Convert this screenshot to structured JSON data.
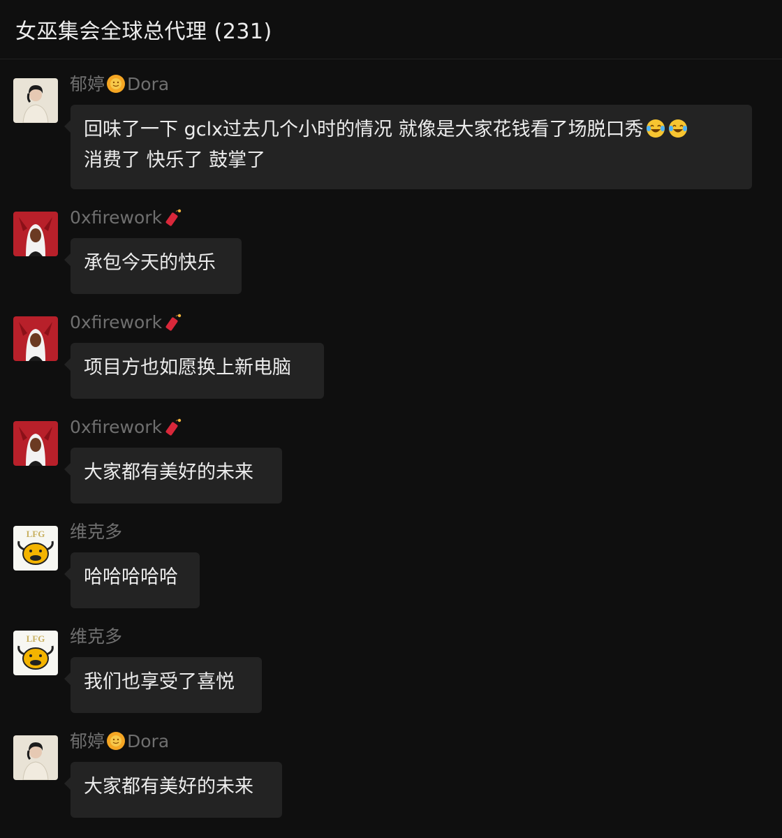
{
  "header": {
    "title": "女巫集会全球总代理 (231)"
  },
  "messages": [
    {
      "sender": "郁婷",
      "sender_suffix": "Dora",
      "sender_icon": "sun-face-icon",
      "avatar": "dora-avatar",
      "lines": [
        "回味了一下 gclx过去几个小时的情况 就像是大家花钱看了场脱口秀",
        "消费了 快乐了 鼓掌了"
      ],
      "emoji": [
        "tears-of-joy-icon",
        "tears-of-joy-icon"
      ]
    },
    {
      "sender": "0xfirework",
      "sender_icon": "firecracker-icon",
      "avatar": "firework-avatar",
      "lines": [
        "承包今天的快乐"
      ]
    },
    {
      "sender": "0xfirework",
      "sender_icon": "firecracker-icon",
      "avatar": "firework-avatar",
      "lines": [
        "项目方也如愿换上新电脑"
      ]
    },
    {
      "sender": "0xfirework",
      "sender_icon": "firecracker-icon",
      "avatar": "firework-avatar",
      "lines": [
        "大家都有美好的未来"
      ]
    },
    {
      "sender": "维克多",
      "avatar": "lfg-bull-avatar",
      "lines": [
        "哈哈哈哈哈"
      ]
    },
    {
      "sender": "维克多",
      "avatar": "lfg-bull-avatar",
      "lines": [
        "我们也享受了喜悦"
      ]
    },
    {
      "sender": "郁婷",
      "sender_suffix": "Dora",
      "sender_icon": "sun-face-icon",
      "avatar": "dora-avatar",
      "lines": [
        "大家都有美好的未来"
      ]
    }
  ],
  "avatar_text": {
    "lfg": "LFG"
  },
  "colors": {
    "background": "#0f0f0f",
    "bubble": "#232323",
    "sender": "#6f6f6f",
    "text": "#ececec"
  }
}
